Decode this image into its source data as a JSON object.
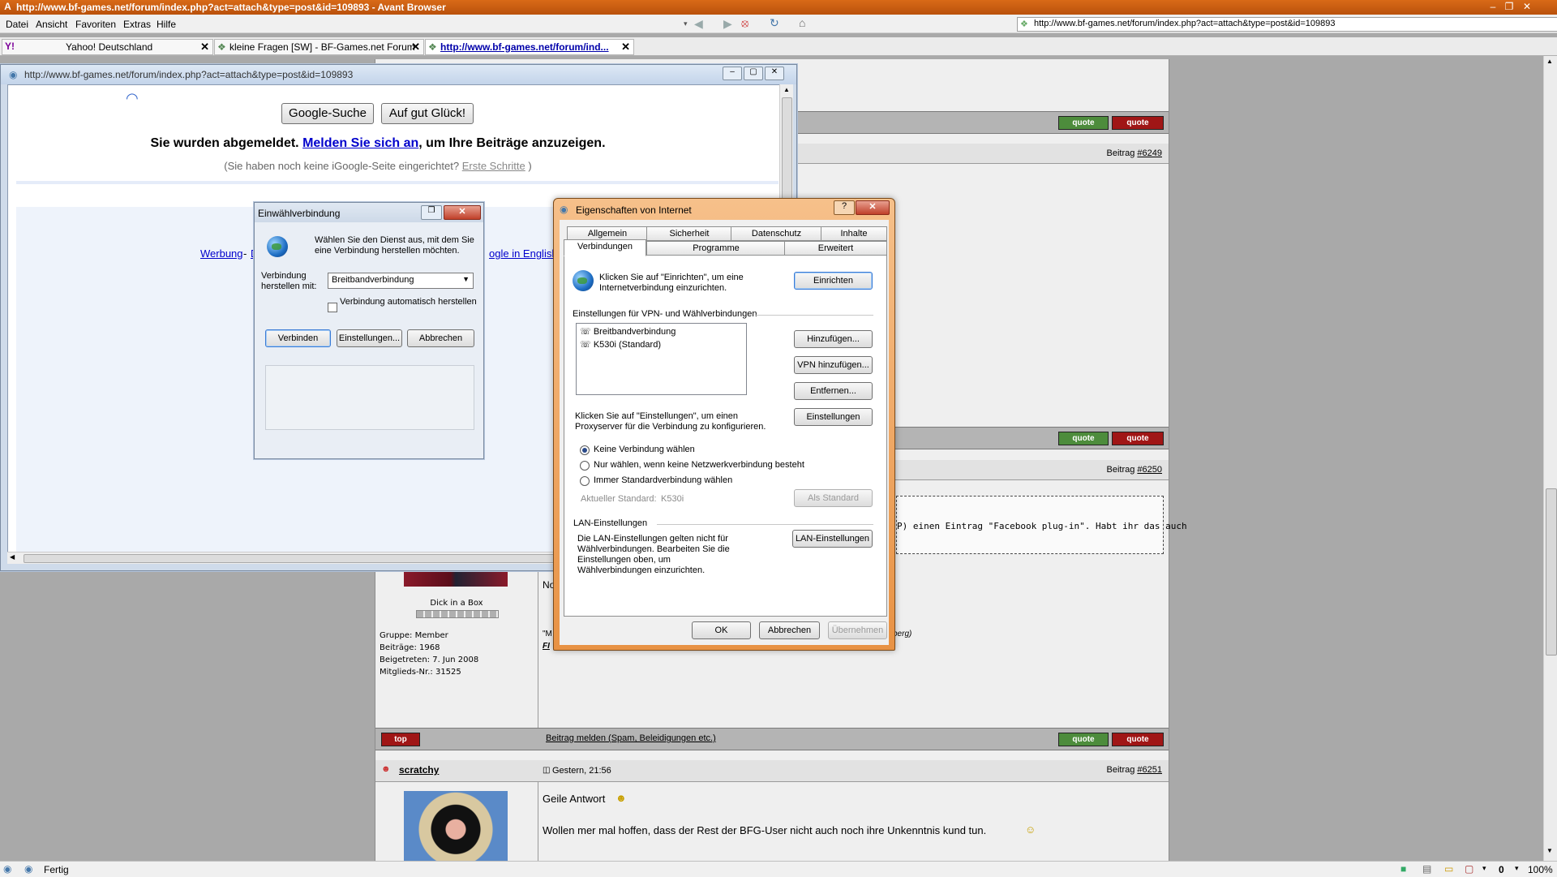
{
  "browser": {
    "title": "http://www.bf-games.net/forum/index.php?act=attach&type=post&id=109893 - Avant Browser",
    "menu": [
      "Datei",
      "Ansicht",
      "Favoriten",
      "Extras",
      "Hilfe"
    ],
    "address": "http://www.bf-games.net/forum/index.php?act=attach&type=post&id=109893",
    "tabs": [
      {
        "label": "Yahoo! Deutschland"
      },
      {
        "label": "kleine Fragen [SW] - BF-Games.net Forum"
      },
      {
        "label": "http://www.bf-games.net/forum/ind..."
      }
    ],
    "status": "Fertig",
    "status_count": "0",
    "zoom": "100%"
  },
  "forum": {
    "quote_label": "quote",
    "beitrag_label": "Beitrag",
    "post1_id": "#6249",
    "post2_id": "#6250",
    "post3_id": "#6251",
    "facebook_text": "P) einen Eintrag \"Facebook plug-in\". Habt ihr das auch",
    "user_title": "Dick in a Box",
    "user_group": "Gruppe: Member",
    "user_posts": "Beiträge: 1968",
    "user_joined": "Beigetreten: 7. Jun 2008",
    "user_member_no": "Mitglieds-Nr.: 31525",
    "partial_no": "No",
    "partial_m": "\"M",
    "partial_berg": "berg)",
    "partial_fi": "FI",
    "top_label": "top",
    "report_link": "Beitrag melden (Spam, Beleidigungen etc.)",
    "next_user": "scratchy",
    "next_date": "Gestern, 21:56",
    "next_line1": "Geile Antwort",
    "next_line2": "Wollen mer mal hoffen, dass der Rest der BFG-User nicht auch noch ihre Unkenntnis kund tun."
  },
  "popup": {
    "url": "http://www.bf-games.net/forum/index.php?act=attach&type=post&id=109893",
    "google_search": "Google-Suche",
    "lucky": "Auf gut Glück!",
    "logged_out_pre": "Sie wurden abgemeldet.",
    "login_link": "Melden Sie sich an",
    "logged_out_post": ", um Ihre Beiträge anzuzeigen.",
    "igoogle_pre": "(Sie haben noch keine iGoogle-Seite eingerichtet?",
    "igoogle_link": "Erste Schritte",
    "igoogle_post": ")",
    "werbung": "Werbung",
    "dash": "-",
    "da_partial": "Da",
    "english_partial": "ogle in English"
  },
  "dialup": {
    "title": "Einwählverbindung",
    "prompt": "Wählen Sie den Dienst aus, mit dem Sie eine Verbindung herstellen möchten.",
    "connect_with_label": "Verbindung herstellen mit:",
    "connect_with_value": "Breitbandverbindung",
    "auto_label": "Verbindung automatisch herstellen",
    "connect_btn": "Verbinden",
    "settings_btn": "Einstellungen...",
    "cancel_btn": "Abbrechen"
  },
  "inet": {
    "title": "Eigenschaften von Internet",
    "tabs_row1": [
      "Allgemein",
      "Sicherheit",
      "Datenschutz",
      "Inhalte"
    ],
    "tabs_row2": [
      "Verbindungen",
      "Programme",
      "Erweitert"
    ],
    "setup_text": "Klicken Sie auf \"Einrichten\", um eine Internetverbindung einzurichten.",
    "setup_btn": "Einrichten",
    "vpn_group": "Einstellungen für VPN- und Wählverbindungen",
    "connections": [
      "Breitbandverbindung",
      "K530i (Standard)"
    ],
    "add_btn": "Hinzufügen...",
    "add_vpn_btn": "VPN hinzufügen...",
    "remove_btn": "Entfernen...",
    "settings_btn": "Einstellungen",
    "proxy_text": "Klicken Sie auf \"Einstellungen\", um einen Proxyserver für die Verbindung zu konfigurieren.",
    "radio1": "Keine Verbindung wählen",
    "radio2": "Nur wählen, wenn keine Netzwerkverbindung besteht",
    "radio3": "Immer Standardverbindung wählen",
    "current_default_label": "Aktueller Standard:",
    "current_default_value": "K530i",
    "set_default_btn": "Als Standard",
    "lan_group": "LAN-Einstellungen",
    "lan_text": "Die LAN-Einstellungen gelten nicht für Wählverbindungen. Bearbeiten Sie die Einstellungen oben, um Wählverbindungen einzurichten.",
    "lan_btn": "LAN-Einstellungen",
    "ok_btn": "OK",
    "cancel_btn": "Abbrechen",
    "apply_btn": "Übernehmen"
  }
}
